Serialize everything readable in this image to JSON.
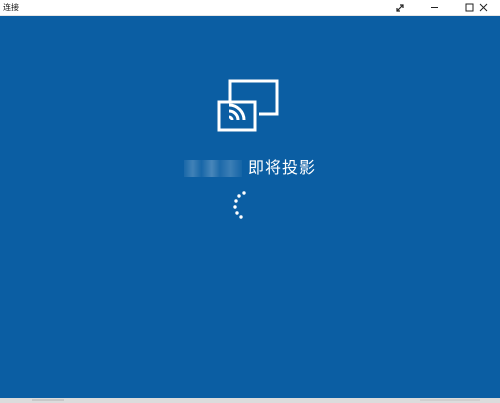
{
  "window": {
    "title": "连接",
    "icons": {
      "expand": "expand-diagonal-icon",
      "minimize": "minimize-icon",
      "maximize": "maximize-icon",
      "close": "close-icon"
    }
  },
  "main": {
    "icon": "cast-screen-icon",
    "device_name": "",
    "status_text": "即将投影",
    "loading_indicator": "spinner-icon"
  },
  "colors": {
    "background": "#0b5ea3",
    "foreground": "#ffffff",
    "titlebar": "#ffffff"
  }
}
